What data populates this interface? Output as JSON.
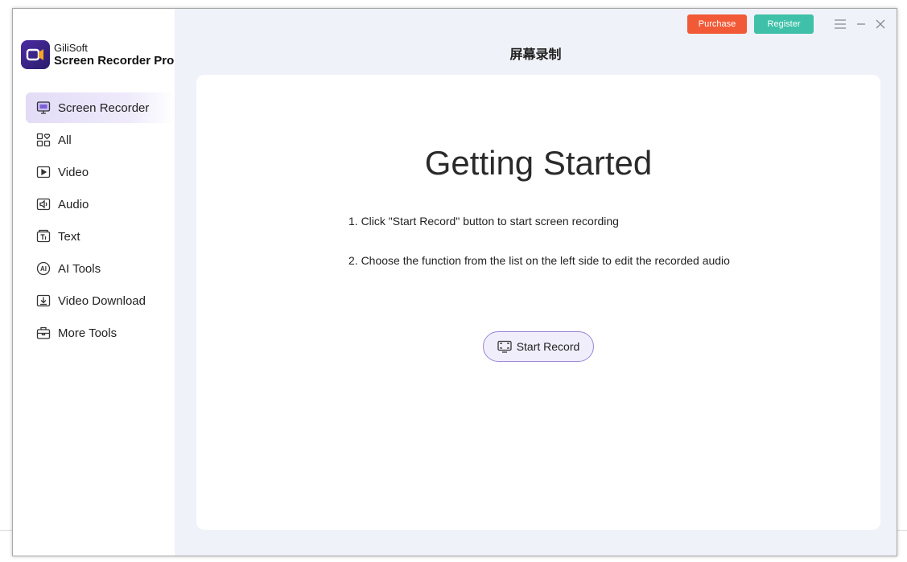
{
  "brand": {
    "company": "GiliSoft",
    "product": "Screen Recorder Pro"
  },
  "topbar": {
    "purchase_label": "Purchase",
    "register_label": "Register",
    "purchase_color": "#f25a37",
    "register_color": "#3ec1a8",
    "menu_icon": "hamburger-icon",
    "minimize_icon": "minimize-icon",
    "close_icon": "close-icon"
  },
  "sidebar": {
    "items": [
      {
        "label": "Screen Recorder",
        "icon": "monitor-icon",
        "active": true
      },
      {
        "label": "All",
        "icon": "grid-heart-icon"
      },
      {
        "label": "Video",
        "icon": "video-play-icon"
      },
      {
        "label": "Audio",
        "icon": "audio-icon"
      },
      {
        "label": "Text",
        "icon": "text-icon"
      },
      {
        "label": "AI Tools",
        "icon": "ai-icon"
      },
      {
        "label": "Video Download",
        "icon": "download-icon"
      },
      {
        "label": "More Tools",
        "icon": "toolbox-icon"
      }
    ]
  },
  "main": {
    "page_title": "屏幕录制",
    "heading": "Getting Started",
    "steps": [
      "1. Click \"Start Record\" button to start screen recording",
      "2. Choose the function from the list on the left side to edit the recorded audio"
    ],
    "start_label": "Start Record",
    "accent": "#9b86d8"
  }
}
